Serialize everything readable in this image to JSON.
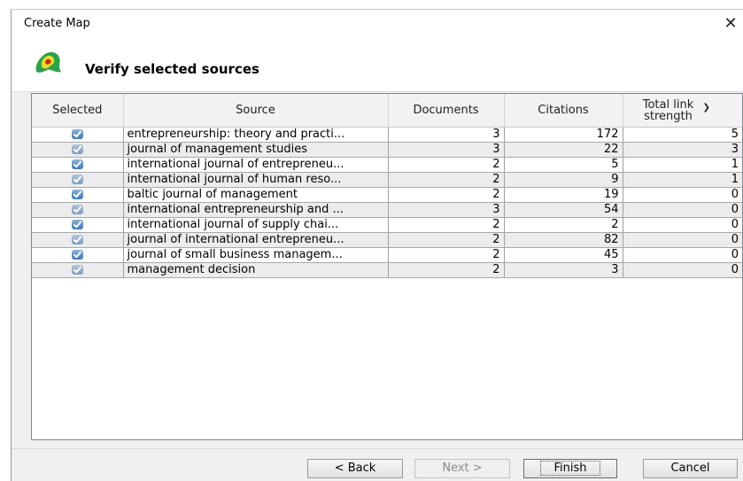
{
  "window": {
    "title": "Create Map"
  },
  "header": {
    "title": "Verify selected sources"
  },
  "table": {
    "columns": [
      "Selected",
      "Source",
      "Documents",
      "Citations",
      "Total link strength"
    ],
    "sorted_column": "Total link strength",
    "rows": [
      {
        "selected": true,
        "source": "entrepreneurship: theory and practi...",
        "documents": "3",
        "citations": "172",
        "link_strength": "5"
      },
      {
        "selected": true,
        "source": "journal of management studies",
        "documents": "3",
        "citations": "22",
        "link_strength": "3"
      },
      {
        "selected": true,
        "source": "international journal of entrepreneu...",
        "documents": "2",
        "citations": "5",
        "link_strength": "1"
      },
      {
        "selected": true,
        "source": "international journal of human reso...",
        "documents": "2",
        "citations": "9",
        "link_strength": "1"
      },
      {
        "selected": true,
        "source": "baltic journal of management",
        "documents": "2",
        "citations": "19",
        "link_strength": "0"
      },
      {
        "selected": true,
        "source": "international entrepreneurship and ...",
        "documents": "3",
        "citations": "54",
        "link_strength": "0"
      },
      {
        "selected": true,
        "source": "international journal of supply chai...",
        "documents": "2",
        "citations": "2",
        "link_strength": "0"
      },
      {
        "selected": true,
        "source": "journal of international entrepreneu...",
        "documents": "2",
        "citations": "82",
        "link_strength": "0"
      },
      {
        "selected": true,
        "source": "journal of small business managem...",
        "documents": "2",
        "citations": "45",
        "link_strength": "0"
      },
      {
        "selected": true,
        "source": "management decision",
        "documents": "2",
        "citations": "3",
        "link_strength": "0"
      }
    ]
  },
  "buttons": {
    "back": "< Back",
    "next": "Next >",
    "finish": "Finish",
    "cancel": "Cancel"
  },
  "icons": {
    "close": "close-icon",
    "logo": "vosviewer-map-icon",
    "sort": "chevron-down-icon",
    "check": "checkbox-checked-icon"
  },
  "colors": {
    "accent": "#3b75bf",
    "row_alt": "#ececec",
    "dialog_bg": "#f0f0f0"
  }
}
